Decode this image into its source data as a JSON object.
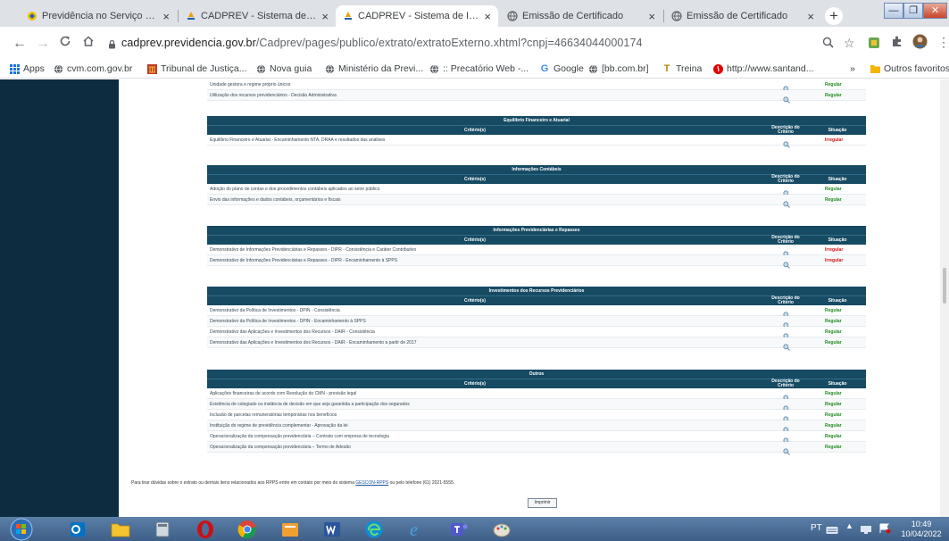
{
  "browser": {
    "tabs": [
      {
        "label": "Previdência no Serviço Público -",
        "active": false
      },
      {
        "label": "CADPREV - Sistema de Informaç",
        "active": false
      },
      {
        "label": "CADPREV - Sistema de Informaç",
        "active": true
      },
      {
        "label": "Emissão de Certificado",
        "active": false
      },
      {
        "label": "Emissão de Certificado",
        "active": false
      }
    ],
    "tab_close": "×",
    "new_tab": "+",
    "window_controls": [
      "—",
      "❐",
      "✕"
    ],
    "url_host": "cadprev.previdencia.gov.br",
    "url_path": "/Cadprev/pages/publico/extrato/extratoExterno.xhtml?cnpj=46634044000174",
    "bookmarks": [
      {
        "label": "Apps",
        "icon": "apps-grid-icon"
      },
      {
        "label": "cvm.com.gov.br",
        "icon": "globe-icon"
      },
      {
        "label": "Tribunal de Justiça...",
        "icon": "tribunal-icon"
      },
      {
        "label": "Nova guia",
        "icon": "globe-icon"
      },
      {
        "label": "Ministério da Previ...",
        "icon": "globe-icon"
      },
      {
        "label": ":: Precatório Web -...",
        "icon": "globe-icon"
      },
      {
        "label": "Google",
        "icon": "google-icon"
      },
      {
        "label": "[bb.com.br]",
        "icon": "globe-icon"
      },
      {
        "label": "Treina",
        "icon": "treina-icon"
      },
      {
        "label": "http://www.santand...",
        "icon": "santander-icon"
      }
    ],
    "bookmarks_more": "»",
    "other_bookmarks": "Outros favoritos"
  },
  "page": {
    "top_partial_rows": [
      {
        "criterio": "Unidade gestora e regime próprio únicos",
        "situacao": "Regular",
        "status": "ok"
      },
      {
        "criterio": "Utilização dos recursos previdenciários - Decisão Administrativa",
        "situacao": "Regular",
        "status": "ok"
      }
    ],
    "col_criterio": "Critério(s)",
    "col_descricao": "Descrição do Critério",
    "col_situacao": "Situação",
    "sections": [
      {
        "title": "Equilíbrio Financeiro e Atuarial",
        "rows": [
          {
            "criterio": "Equilíbrio Financeiro e Atuarial - Encaminhamento NTA, DRAA e resultados das análises",
            "situacao": "Irregular",
            "status": "bad"
          }
        ]
      },
      {
        "title": "Informações Contábeis",
        "rows": [
          {
            "criterio": "Adoção do plano de contas e dos procedimentos contábeis aplicados ao setor público",
            "situacao": "Regular",
            "status": "ok"
          },
          {
            "criterio": "Envio das informações e dados contábeis, orçamentários e fiscais",
            "situacao": "Regular",
            "status": "ok"
          }
        ]
      },
      {
        "title": "Informações Previdenciárias e Repasses",
        "rows": [
          {
            "criterio": "Demonstrativo de Informações Previdenciárias e Repasses - DIPR - Consistência e Caráter Contributivo",
            "situacao": "Irregular",
            "status": "bad"
          },
          {
            "criterio": "Demonstrativo de Informações Previdenciárias e Repasses - DIPR - Encaminhamento à SPPS",
            "situacao": "Irregular",
            "status": "bad"
          }
        ]
      },
      {
        "title": "Investimentos dos Recursos Previdenciários",
        "rows": [
          {
            "criterio": "Demonstrativo da Política de Investimentos - DPIN - Consistência",
            "situacao": "Regular",
            "status": "ok"
          },
          {
            "criterio": "Demonstrativo da Política de Investimentos - DPIN - Encaminhamento à SPPS",
            "situacao": "Regular",
            "status": "ok"
          },
          {
            "criterio": "Demonstrativo das Aplicações e Investimentos dos Recursos - DAIR - Consistência",
            "situacao": "Regular",
            "status": "ok"
          },
          {
            "criterio": "Demonstrativo das Aplicações e Investimentos dos Recursos - DAIR - Encaminhamento a partir de 2017",
            "situacao": "Regular",
            "status": "ok"
          }
        ]
      },
      {
        "title": "Outros",
        "rows": [
          {
            "criterio": "Aplicações financeiras de acordo com Resolução do CMN - previsão legal",
            "situacao": "Regular",
            "status": "ok"
          },
          {
            "criterio": "Existência de colegiado ou instância de decisão em que seja garantida a participação dos segurados",
            "situacao": "Regular",
            "status": "ok"
          },
          {
            "criterio": "Inclusão de parcelas remuneratórias temporárias nos benefícios",
            "situacao": "Regular",
            "status": "ok"
          },
          {
            "criterio": "Instituição do regime de previdência complementar - Aprovação da lei",
            "situacao": "Regular",
            "status": "ok"
          },
          {
            "criterio": "Operacionalização da compensação previdenciária – Contrato com empresa de tecnologia",
            "situacao": "Regular",
            "status": "ok"
          },
          {
            "criterio": "Operacionalização da compensação previdenciária – Termo de Adesão",
            "situacao": "Regular",
            "status": "ok"
          }
        ]
      }
    ],
    "footnote_before": "Para tirar dúvidas sobre o extrato ou demais itens relacionados aos RPPS entre em contato por meio do sistema",
    "footnote_link": "GESCON-RPPS",
    "footnote_after": "ou pelo telefone (61) 2021-5555.",
    "print_button": "Imprimir"
  },
  "taskbar": {
    "lang": "PT",
    "time": "10:49",
    "date": "10/04/2022"
  },
  "colors": {
    "header_bg": "#174a63",
    "leftnav_bg": "#0e2c3f",
    "regular": "#1f8a1f",
    "irregular": "#d01010"
  }
}
